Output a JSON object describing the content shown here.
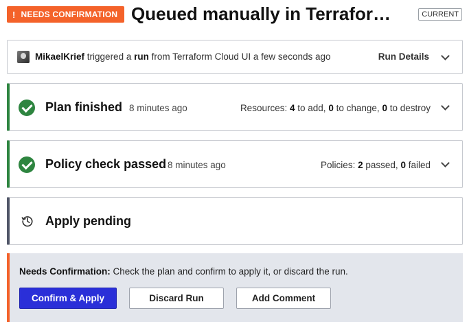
{
  "header": {
    "status_badge": "NEEDS CONFIRMATION",
    "status_badge_icon": "!",
    "title": "Queued manually in Terrafor…",
    "current_badge": "CURRENT"
  },
  "trigger": {
    "user": "MikaelKrief",
    "text_triggered": "triggered a",
    "text_run": "run",
    "text_from": "from Terraform Cloud UI a few seconds ago",
    "details_label": "Run Details"
  },
  "plan": {
    "title": "Plan finished",
    "time": "8 minutes ago",
    "summary_prefix": "Resources:",
    "add_count": "4",
    "add_label": "to add,",
    "change_count": "0",
    "change_label": "to change,",
    "destroy_count": "0",
    "destroy_label": "to destroy"
  },
  "policy": {
    "title": "Policy check passed",
    "time": "8 minutes ago",
    "summary_prefix": "Policies:",
    "passed_count": "2",
    "passed_label": "passed,",
    "failed_count": "0",
    "failed_label": "failed"
  },
  "apply": {
    "title": "Apply pending"
  },
  "confirm": {
    "label": "Needs Confirmation:",
    "message": "Check the plan and confirm to apply it, or discard the run.",
    "confirm_button": "Confirm & Apply",
    "discard_button": "Discard Run",
    "comment_button": "Add Comment"
  },
  "colors": {
    "needs_confirmation": "#f4622a",
    "success": "#2e8540",
    "primary_button": "#2a2fd8",
    "pending": "#505668",
    "panel_bg": "#e3e6ec"
  },
  "icons": {
    "status": "exclamation-icon",
    "plan": "check-circle-icon",
    "policy": "check-circle-icon",
    "apply": "history-icon",
    "expand": "chevron-down-icon"
  }
}
